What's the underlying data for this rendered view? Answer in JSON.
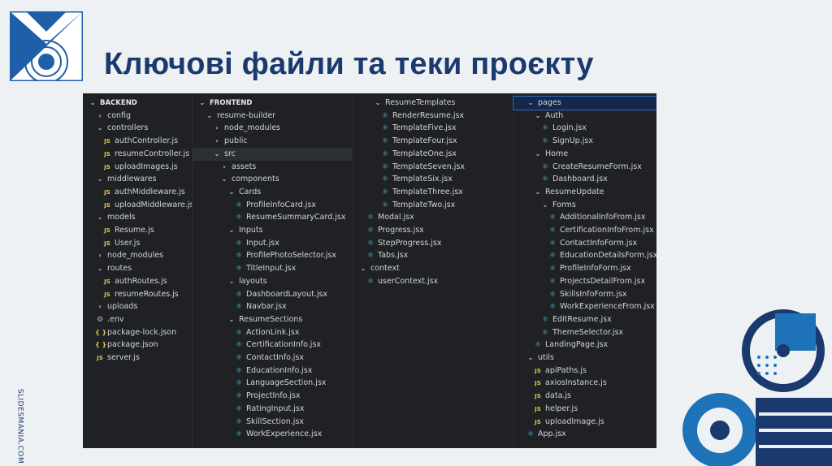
{
  "slide": {
    "title": "Ключові файли та теки проєкту",
    "side_text": "SLIDESMANIA.COM",
    "colors": {
      "title": "#1a3a6e",
      "accent": "#1e73b8",
      "panel": "#1f2124"
    }
  },
  "panels": [
    {
      "name": "backend",
      "rows": [
        {
          "label": "BACKEND",
          "icon": "chevron-down",
          "indent": 0,
          "hdr": true
        },
        {
          "label": "config",
          "icon": "chevron-right",
          "indent": 1
        },
        {
          "label": "controllers",
          "icon": "chevron-down",
          "indent": 1
        },
        {
          "label": "authController.js",
          "icon": "js",
          "indent": 2
        },
        {
          "label": "resumeController.js",
          "icon": "js",
          "indent": 2
        },
        {
          "label": "uploadImages.js",
          "icon": "js",
          "indent": 2
        },
        {
          "label": "middlewares",
          "icon": "chevron-down",
          "indent": 1
        },
        {
          "label": "authMiddleware.js",
          "icon": "js",
          "indent": 2
        },
        {
          "label": "uploadMiddleware.js",
          "icon": "js",
          "indent": 2
        },
        {
          "label": "models",
          "icon": "chevron-down",
          "indent": 1
        },
        {
          "label": "Resume.js",
          "icon": "js",
          "indent": 2
        },
        {
          "label": "User.js",
          "icon": "js",
          "indent": 2
        },
        {
          "label": "node_modules",
          "icon": "chevron-right",
          "indent": 1
        },
        {
          "label": "routes",
          "icon": "chevron-down",
          "indent": 1
        },
        {
          "label": "authRoutes.js",
          "icon": "js",
          "indent": 2
        },
        {
          "label": "resumeRoutes.js",
          "icon": "js",
          "indent": 2
        },
        {
          "label": "uploads",
          "icon": "chevron-right",
          "indent": 1
        },
        {
          "label": ".env",
          "icon": "gear",
          "indent": 1
        },
        {
          "label": "package-lock.json",
          "icon": "braces",
          "indent": 1
        },
        {
          "label": "package.json",
          "icon": "braces",
          "indent": 1
        },
        {
          "label": "server.js",
          "icon": "js",
          "indent": 1
        }
      ]
    },
    {
      "name": "frontend",
      "rows": [
        {
          "label": "FRONTEND",
          "icon": "chevron-down",
          "indent": 0,
          "hdr": true
        },
        {
          "label": "resume-builder",
          "icon": "chevron-down",
          "indent": 1
        },
        {
          "label": "node_modules",
          "icon": "chevron-right",
          "indent": 2
        },
        {
          "label": "public",
          "icon": "chevron-right",
          "indent": 2
        },
        {
          "label": "src",
          "icon": "chevron-down",
          "indent": 2,
          "sel": true
        },
        {
          "label": "assets",
          "icon": "chevron-right",
          "indent": 3
        },
        {
          "label": "components",
          "icon": "chevron-down",
          "indent": 3
        },
        {
          "label": "Cards",
          "icon": "chevron-down",
          "indent": 4
        },
        {
          "label": "ProfileInfoCard.jsx",
          "icon": "react",
          "indent": 5
        },
        {
          "label": "ResumeSummaryCard.jsx",
          "icon": "react",
          "indent": 5
        },
        {
          "label": "Inputs",
          "icon": "chevron-down",
          "indent": 4
        },
        {
          "label": "Input.jsx",
          "icon": "react",
          "indent": 5
        },
        {
          "label": "ProfilePhotoSelector.jsx",
          "icon": "react",
          "indent": 5
        },
        {
          "label": "TitleInput.jsx",
          "icon": "react",
          "indent": 5
        },
        {
          "label": "layouts",
          "icon": "chevron-down",
          "indent": 4
        },
        {
          "label": "DashboardLayout.jsx",
          "icon": "react",
          "indent": 5
        },
        {
          "label": "Navbar.jsx",
          "icon": "react",
          "indent": 5
        },
        {
          "label": "ResumeSections",
          "icon": "chevron-down",
          "indent": 4
        },
        {
          "label": "ActionLink.jsx",
          "icon": "react",
          "indent": 5
        },
        {
          "label": "CertificationInfo.jsx",
          "icon": "react",
          "indent": 5
        },
        {
          "label": "ContactInfo.jsx",
          "icon": "react",
          "indent": 5
        },
        {
          "label": "EducationInfo.jsx",
          "icon": "react",
          "indent": 5
        },
        {
          "label": "LanguageSection.jsx",
          "icon": "react",
          "indent": 5
        },
        {
          "label": "ProjectInfo.jsx",
          "icon": "react",
          "indent": 5
        },
        {
          "label": "RatingInput.jsx",
          "icon": "react",
          "indent": 5
        },
        {
          "label": "SkillSection.jsx",
          "icon": "react",
          "indent": 5
        },
        {
          "label": "WorkExperience.jsx",
          "icon": "react",
          "indent": 5
        }
      ]
    },
    {
      "name": "components-cont",
      "rows": [
        {
          "label": "ResumeTemplates",
          "icon": "chevron-down",
          "indent": 2
        },
        {
          "label": "RenderResume.jsx",
          "icon": "react",
          "indent": 3
        },
        {
          "label": "TemplateFive.jsx",
          "icon": "react",
          "indent": 3
        },
        {
          "label": "TemplateFour.jsx",
          "icon": "react",
          "indent": 3
        },
        {
          "label": "TemplateOne.jsx",
          "icon": "react",
          "indent": 3
        },
        {
          "label": "TemplateSeven.jsx",
          "icon": "react",
          "indent": 3
        },
        {
          "label": "TemplateSix.jsx",
          "icon": "react",
          "indent": 3
        },
        {
          "label": "TemplateThree.jsx",
          "icon": "react",
          "indent": 3
        },
        {
          "label": "TemplateTwo.jsx",
          "icon": "react",
          "indent": 3
        },
        {
          "label": "Modal.jsx",
          "icon": "react",
          "indent": 1
        },
        {
          "label": "Progress.jsx",
          "icon": "react",
          "indent": 1
        },
        {
          "label": "StepProgress.jsx",
          "icon": "react",
          "indent": 1
        },
        {
          "label": "Tabs.jsx",
          "icon": "react",
          "indent": 1
        },
        {
          "label": "context",
          "icon": "chevron-down",
          "indent": 0
        },
        {
          "label": "userContext.jsx",
          "icon": "react",
          "indent": 1
        }
      ]
    },
    {
      "name": "pages",
      "rows": [
        {
          "label": "pages",
          "icon": "chevron-down",
          "indent": 1,
          "active": true
        },
        {
          "label": "Auth",
          "icon": "chevron-down",
          "indent": 2
        },
        {
          "label": "Login.jsx",
          "icon": "react",
          "indent": 3
        },
        {
          "label": "SignUp.jsx",
          "icon": "react",
          "indent": 3
        },
        {
          "label": "Home",
          "icon": "chevron-down",
          "indent": 2
        },
        {
          "label": "CreateResumeForm.jsx",
          "icon": "react",
          "indent": 3
        },
        {
          "label": "Dashboard.jsx",
          "icon": "react",
          "indent": 3
        },
        {
          "label": "ResumeUpdate",
          "icon": "chevron-down",
          "indent": 2
        },
        {
          "label": "Forms",
          "icon": "chevron-down",
          "indent": 3
        },
        {
          "label": "AdditionalInfoFrom.jsx",
          "icon": "react",
          "indent": 4
        },
        {
          "label": "CertificationInfoFrom.jsx",
          "icon": "react",
          "indent": 4
        },
        {
          "label": "ContactInfoForm.jsx",
          "icon": "react",
          "indent": 4
        },
        {
          "label": "EducationDetailsForm.jsx",
          "icon": "react",
          "indent": 4
        },
        {
          "label": "ProfileInfoForm.jsx",
          "icon": "react",
          "indent": 4
        },
        {
          "label": "ProjectsDetailFrom.jsx",
          "icon": "react",
          "indent": 4
        },
        {
          "label": "SkillsInfoForm.jsx",
          "icon": "react",
          "indent": 4
        },
        {
          "label": "WorkExperienceFrom.jsx",
          "icon": "react",
          "indent": 4
        },
        {
          "label": "EditResume.jsx",
          "icon": "react",
          "indent": 3
        },
        {
          "label": "ThemeSelector.jsx",
          "icon": "react",
          "indent": 3
        },
        {
          "label": "LandingPage.jsx",
          "icon": "react",
          "indent": 2
        },
        {
          "label": "utils",
          "icon": "chevron-down",
          "indent": 1
        },
        {
          "label": "apiPaths.js",
          "icon": "js",
          "indent": 2
        },
        {
          "label": "axiosInstance.js",
          "icon": "js",
          "indent": 2
        },
        {
          "label": "data.js",
          "icon": "js",
          "indent": 2
        },
        {
          "label": "helper.js",
          "icon": "js",
          "indent": 2
        },
        {
          "label": "uploadImage.js",
          "icon": "js",
          "indent": 2
        },
        {
          "label": "App.jsx",
          "icon": "react",
          "indent": 1
        }
      ]
    }
  ]
}
